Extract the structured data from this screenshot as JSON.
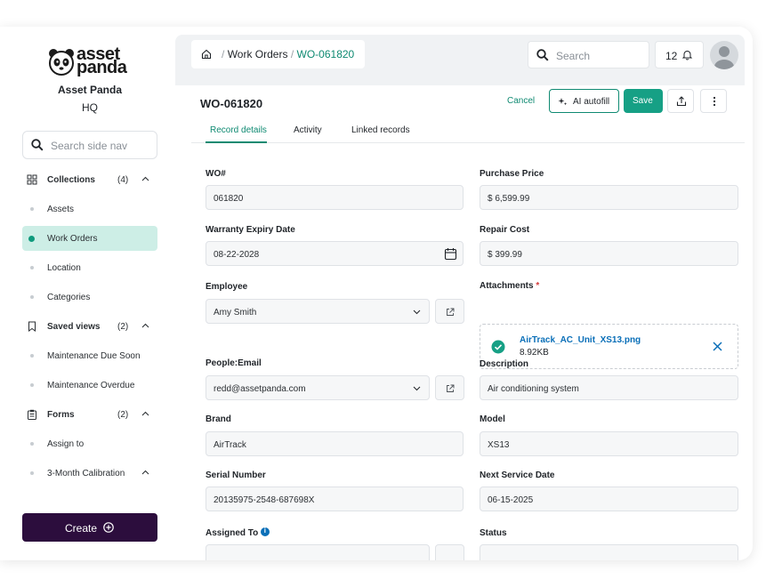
{
  "brand": {
    "logo_line1": "asset",
    "logo_line2": "panda",
    "org_name": "Asset Panda",
    "org_sub": "HQ"
  },
  "sidebar": {
    "search_placeholder": "Search side nav",
    "items": [
      {
        "label": "Collections",
        "count": "(4)",
        "type": "section",
        "icon": "grid-icon"
      },
      {
        "label": "Assets",
        "type": "item"
      },
      {
        "label": "Work Orders",
        "type": "item",
        "active": true
      },
      {
        "label": "Location",
        "type": "item"
      },
      {
        "label": "Categories",
        "type": "item"
      },
      {
        "label": "Saved views",
        "count": "(2)",
        "type": "section",
        "icon": "bookmark-icon"
      },
      {
        "label": "Maintenance Due Soon",
        "type": "item"
      },
      {
        "label": "Maintenance Overdue",
        "type": "item"
      },
      {
        "label": "Forms",
        "count": "(2)",
        "type": "section",
        "icon": "clipboard-icon"
      },
      {
        "label": "Assign to",
        "type": "item"
      },
      {
        "label": "3-Month Calibration",
        "type": "item"
      }
    ],
    "create_label": "Create"
  },
  "topbar": {
    "breadcrumb": {
      "sep": "/",
      "parent": "Work Orders",
      "current": "WO-061820"
    },
    "search_placeholder": "Search",
    "notification_count": "12"
  },
  "record": {
    "title": "WO-061820",
    "cancel_label": "Cancel",
    "ai_label": "AI autofill",
    "save_label": "Save",
    "tabs": [
      "Record details",
      "Activity",
      "Linked records"
    ]
  },
  "form": {
    "wo_label": "WO#",
    "wo_value": "061820",
    "purchase_label": "Purchase Price",
    "purchase_value": "$ 6,599.99",
    "warranty_label": "Warranty Expiry Date",
    "warranty_value": "08-22-2028",
    "repair_label": "Repair Cost",
    "repair_value": "$ 399.99",
    "employee_label": "Employee",
    "employee_value": "Amy Smith",
    "attachments_label": "Attachments",
    "attachments_req": "*",
    "attachment_name": "AirTrack_AC_Unit_XS13.png",
    "attachment_size": "8.92KB",
    "email_label": "People:Email",
    "email_value": "redd@assetpanda.com",
    "description_label": "Description",
    "description_value": "Air conditioning system",
    "brand_label": "Brand",
    "brand_value": "AirTrack",
    "model_label": "Model",
    "model_value": "XS13",
    "serial_label": "Serial Number",
    "serial_value": "20135975-2548-687698X",
    "next_service_label": "Next Service Date",
    "next_service_value": "06-15-2025",
    "assigned_label": "Assigned To",
    "status_label": "Status"
  },
  "colors": {
    "accent": "#0f8a72",
    "save": "#16a085",
    "create": "#2c0d3d",
    "active_nav": "#cdeee6",
    "link": "#0a6fb8"
  }
}
